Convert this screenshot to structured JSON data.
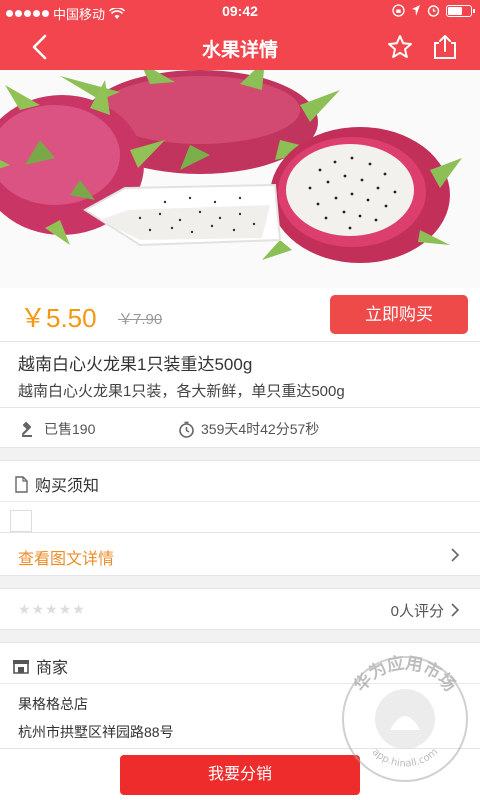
{
  "status_bar": {
    "carrier": "中国移动",
    "time": "09:42"
  },
  "nav": {
    "title": "水果详情",
    "back_icon": "chevron-left-icon",
    "favorite_icon": "star-outline-icon",
    "share_icon": "share-icon"
  },
  "hero": {
    "image_icon": "dragon-fruit-photo"
  },
  "product": {
    "price": "￥5.50",
    "original_price": "￥7.90",
    "buy_label": "立即购买",
    "name": "越南白心火龙果1只装重达500g",
    "description": "越南白心火龙果1只装，各大新鲜，单只重达500g"
  },
  "stats": {
    "sold": "已售190",
    "countdown": "359天4时42分57秒"
  },
  "notice": {
    "title": "购买须知"
  },
  "detail_link": {
    "label": "查看图文详情"
  },
  "rating": {
    "count_label": "0人评分",
    "stars": 0
  },
  "merchant": {
    "title": "商家",
    "shop_name": "果格格总店",
    "address": "杭州市拱墅区祥园路88号"
  },
  "bottom": {
    "distribute_label": "我要分销"
  },
  "watermark": {
    "text": "华为应用市场",
    "url": "app.hinall.com"
  },
  "colors": {
    "brand": "#f2454d",
    "price": "#f39813",
    "link": "#ee8c2a",
    "primary_button": "#ee2c2c"
  }
}
